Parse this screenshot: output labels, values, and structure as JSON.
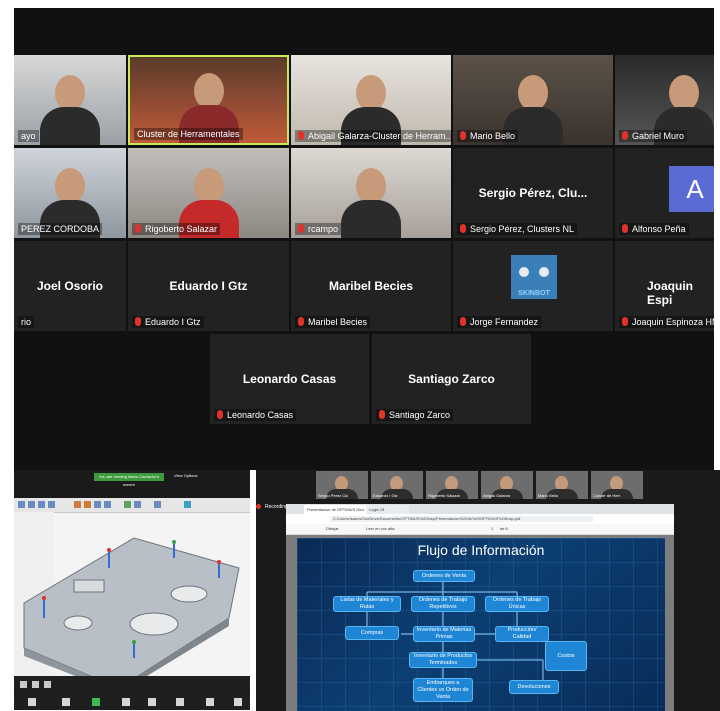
{
  "gallery": {
    "tiles": [
      {
        "name": "ayo",
        "video": true,
        "muted": false
      },
      {
        "name": "Cluster de Herramentales",
        "video": true,
        "muted": false,
        "active": true
      },
      {
        "name": "Abigail Galarza-Cluster de Herram...",
        "video": true,
        "muted": true
      },
      {
        "name": "Mario Bello",
        "video": true,
        "muted": true
      },
      {
        "name": "Gabriel Muro",
        "video": true,
        "muted": true
      },
      {
        "name": "PEREZ CORDOBA",
        "video": true,
        "muted": false
      },
      {
        "name": "Rigoberto Salazar",
        "video": true,
        "muted": true
      },
      {
        "name": "rcampo",
        "video": true,
        "muted": true
      },
      {
        "name": "Sergio Pérez, Clusters NL",
        "video": false,
        "muted": true,
        "display_name": "Sergio Pérez, Clu..."
      },
      {
        "name": "Alfonso Peña",
        "video": false,
        "muted": true,
        "avatar": "A"
      },
      {
        "name": "rio",
        "video": false,
        "muted": false,
        "display_name": "Joel Osorio"
      },
      {
        "name": "Eduardo I Gtz",
        "video": false,
        "muted": true,
        "display_name": "Eduardo I Gtz"
      },
      {
        "name": "Maribel Becies",
        "video": false,
        "muted": true,
        "display_name": "Maribel Becies"
      },
      {
        "name": "Jorge Fernandez",
        "video": false,
        "muted": true,
        "avatar_image": "robot",
        "avatar_text": "SKINBOT"
      },
      {
        "name": "Joaquin Espinoza HM",
        "video": false,
        "muted": true,
        "display_name": "Joaquin Espi"
      },
      {
        "name": "Leonardo Casas",
        "video": false,
        "muted": true,
        "display_name": "Leonardo Casas"
      },
      {
        "name": "Santiago Zarco",
        "video": false,
        "muted": true,
        "display_name": "Santiago Zarco"
      }
    ]
  },
  "share_left": {
    "banner": "You are viewing Mario Camacho's screen",
    "view_options": "View Options"
  },
  "share_right": {
    "recording": "Recording",
    "thumbs": [
      "Sergio Pérez Clu",
      "Eduardo I Gtz",
      "Rigoberto Salazar",
      "Abigail Galarza",
      "Mario Bello",
      "Cluster de Herr"
    ],
    "browser": {
      "tabs": [
        "Presentacion de OPTIMUS Dinz",
        "Login 15"
      ],
      "url": "C:/Users/Isaura/OneDrive/Documents/OPTIMUS%20Insp/Presentacion%20de%20OPTIMUS%20Insp.pdf",
      "pdf_tools": [
        "Dibujar",
        "Leer en voz alta"
      ],
      "page": "1",
      "page_total": "de 6"
    },
    "slide": {
      "title": "Flujo de Información",
      "boxes": {
        "ordenes_venta": "Ordenes de Venta",
        "listas": "Listas de Materiales y Rutas",
        "ordenes_repetitivos": "Ordenes de Trabajo Repetitivos",
        "ordenes_unicas": "Ordenes de Trabajo Únicas",
        "compras": "Compras",
        "inventario_materias": "Inventario de Materias Primas",
        "produccion": "Producción/ Calidad",
        "inventario_productos": "Inventario de Productos Terminados",
        "costos": "Costos",
        "embarques": "Embarques a Clientes vs Orden de Venta",
        "devoluciones": "Devoluciones"
      }
    }
  }
}
